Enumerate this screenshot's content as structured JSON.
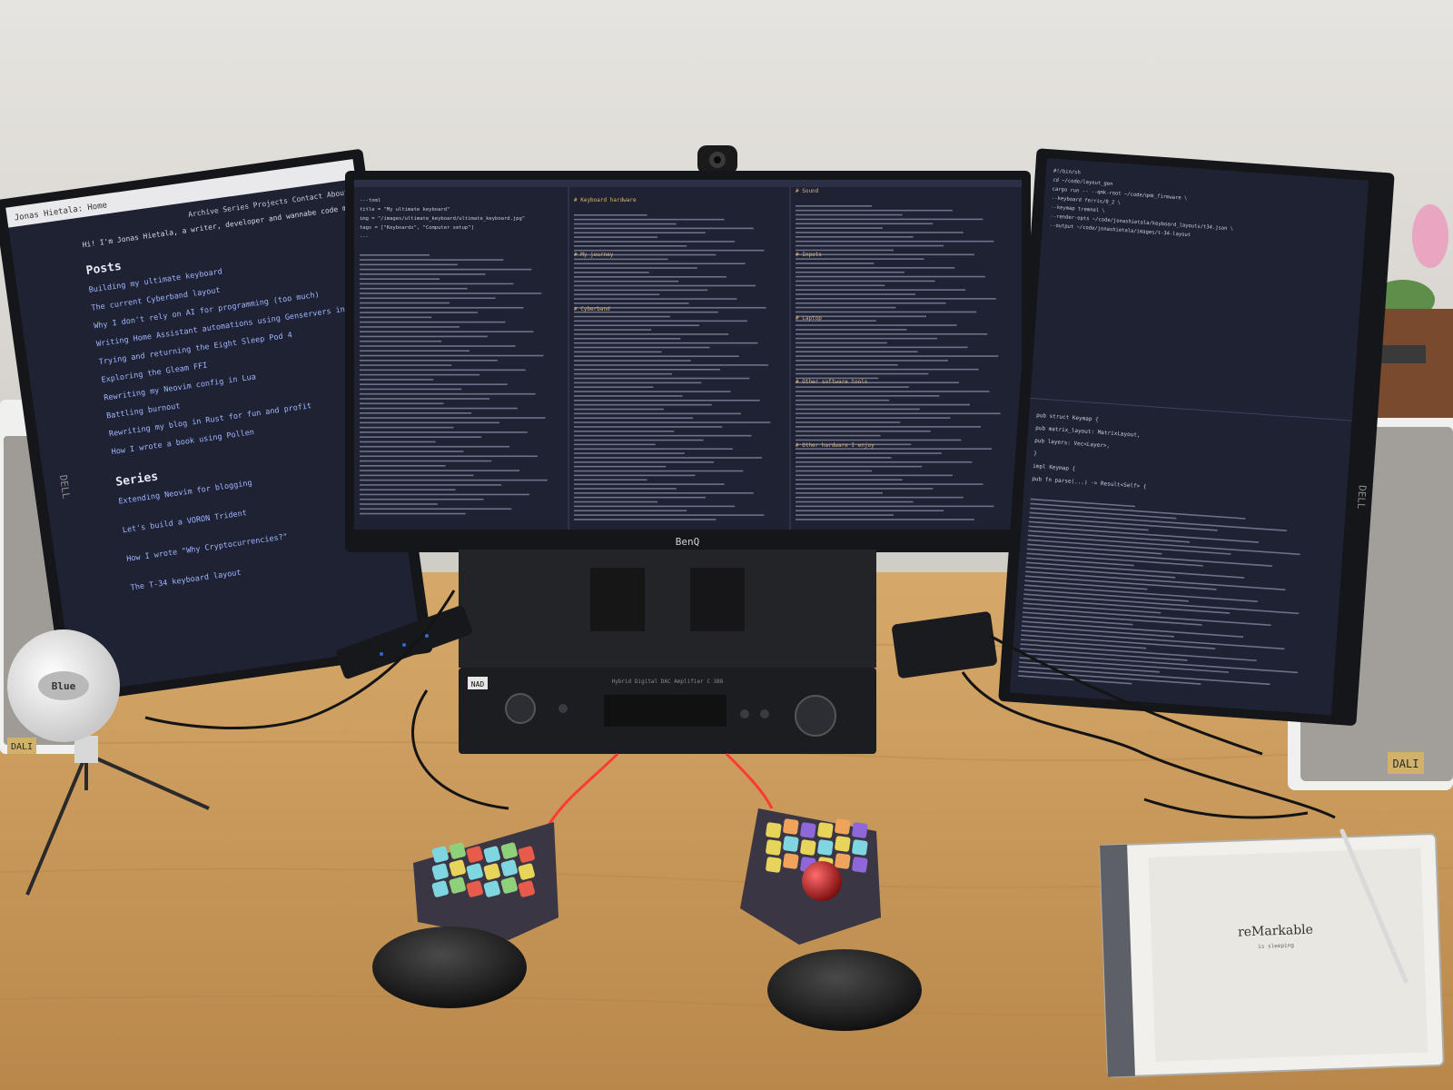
{
  "colors": {
    "wall": "#dcd9d4",
    "desk": "#c99a5c",
    "desk_dark": "#a9783f",
    "screen_bg": "#1e2233",
    "bezel": "#15161a",
    "amp": "#1c1d21",
    "speaker_fabric": "#9f9b96",
    "key_cyan": "#7fd6e0",
    "key_purple": "#8e67d9",
    "key_green": "#8fd17a",
    "key_yellow": "#e7d45a",
    "key_red": "#e85b4a",
    "key_orange": "#f0a35a",
    "cable_red": "#ff3b2b"
  },
  "left_monitor": {
    "brand": "DELL",
    "browser_tab": "Jonas Hietala: Home",
    "site_nav": "Archive  Series  Projects  Contact  About",
    "intro": "Hi! I'm Jonas Hietala, a writer, developer and wannabe code monkey.",
    "posts_heading": "Posts",
    "posts": [
      "Building my ultimate keyboard",
      "The current Cyberband layout",
      "Why I don't rely on AI for programming (too much)",
      "Writing Home Assistant automations using Genservers in Elixir",
      "Trying and returning the Eight Sleep Pod 4",
      "Exploring the Gleam FFI",
      "Rewriting my Neovim config in Lua",
      "Battling burnout",
      "Rewriting my blog in Rust for fun and profit",
      "How I wrote a book using Pollen"
    ],
    "series_heading": "Series",
    "series": [
      "Extending Neovim for blogging",
      "Let's build a VORON Trident",
      "How I wrote \"Why Cryptocurrencies?\"",
      "The T-34 keyboard layout"
    ]
  },
  "center_monitor": {
    "brand": "BenQ",
    "pane_left_lines": [
      "---toml",
      "title = \"My ultimate keyboard\"",
      "img = \"/images/ultimate_keyboard/ultimate_keyboard.jpg\"",
      "tags = [\"Keyboards\", \"Computer setup\"]",
      "---"
    ],
    "pane_mid_lines": [
      "# Keyboard hardware",
      "# My journey",
      "# Cyberband"
    ],
    "pane_right_lines": [
      "# Sound",
      "# Inputs",
      "# Laptop",
      "# Other software tools",
      "# Other hardware I enjoy"
    ]
  },
  "right_monitor": {
    "brand": "DELL",
    "top_lines": [
      "#!/bin/sh",
      "cd ~/code/layout_gen",
      "cargo run -- --qmk-root ~/code/qmk_firmware \\",
      "  --keyboard ferris/0_2 \\",
      "  --keymap tremnel \\",
      "  --render-opts ~/code/jonashietala/keyboard_layouts/t34.json \\",
      "  --output ~/code/jonashietala/images/t-34-layout"
    ],
    "bottom_lines": [
      "pub struct Keymap {",
      "  pub matrix_layout: MatrixLayout,",
      "  pub layers: Vec<Layer>,",
      "}",
      "impl Keymap {",
      "  pub fn parse(...) -> Result<Self> {"
    ]
  },
  "amplifier": {
    "brand": "NAD",
    "model_text": "Hybrid Digital DAC Amplifier C 388"
  },
  "speakers": {
    "brand": "DALI"
  },
  "tablet": {
    "brand": "reMarkable",
    "tagline": "is sleeping"
  },
  "microphone": {
    "brand": "Blue"
  }
}
